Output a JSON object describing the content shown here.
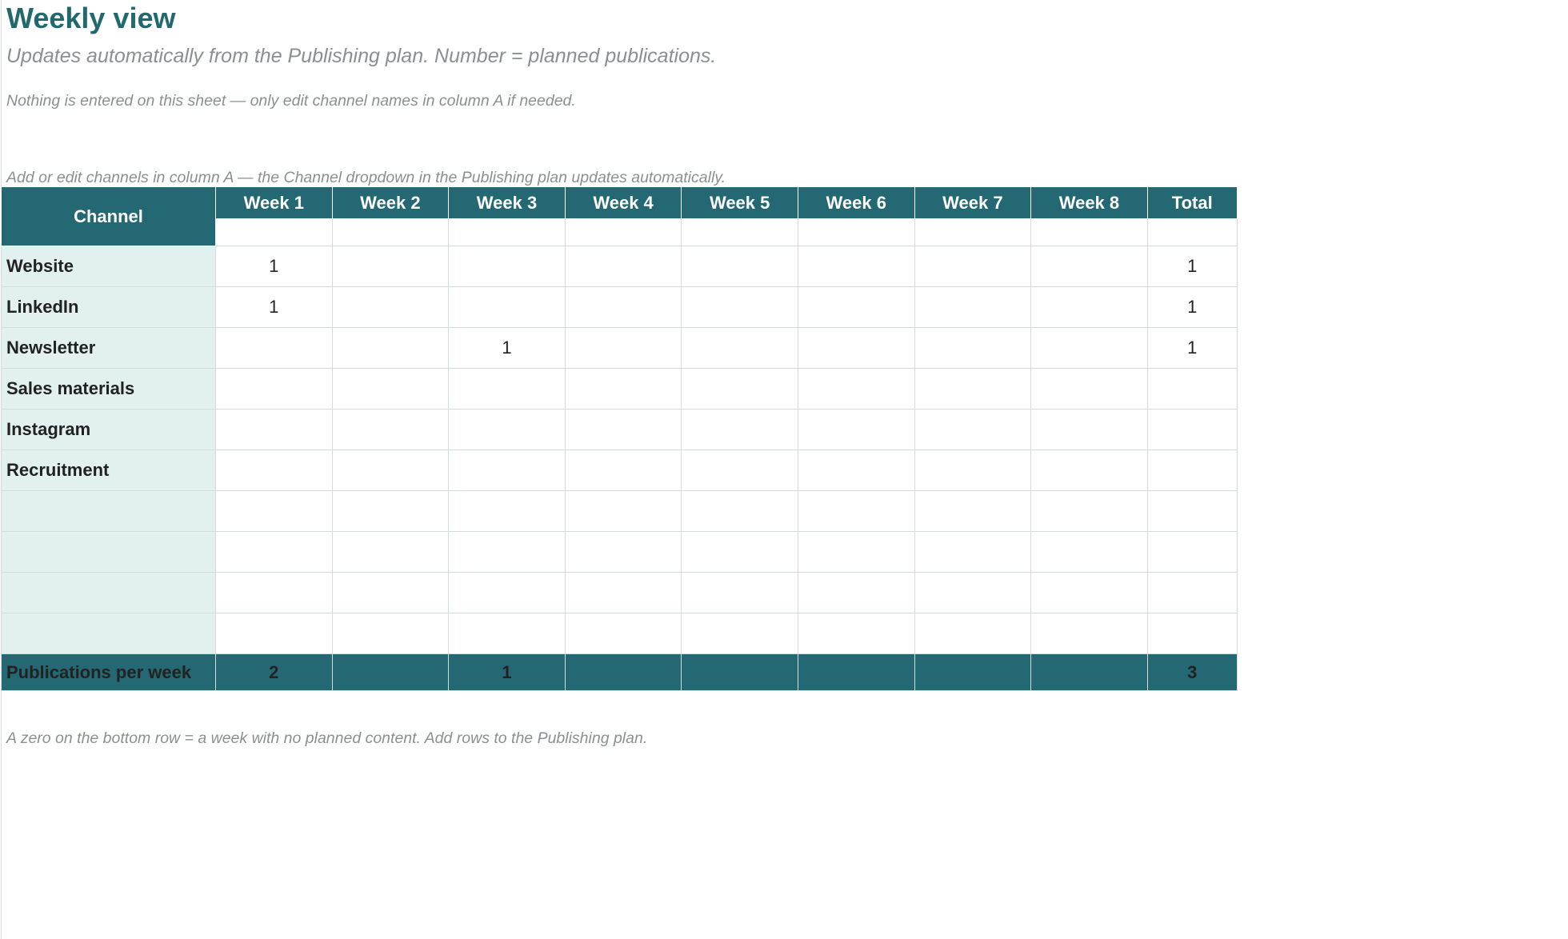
{
  "header": {
    "title": "Weekly view",
    "subtitle": "Updates automatically from the Publishing plan. Number = planned publications."
  },
  "notes": {
    "top": "Nothing is entered on this sheet — only edit channel names in column A if needed.",
    "above_table": "Add or edit channels in column A — the Channel dropdown in the Publishing plan updates automatically.",
    "bottom": "A zero on the bottom row = a week with no planned content. Add rows to the Publishing plan."
  },
  "table": {
    "channel_header": "Channel",
    "week_headers": [
      "Week 1",
      "Week 2",
      "Week 3",
      "Week 4",
      "Week 5",
      "Week 6",
      "Week 7",
      "Week 8"
    ],
    "total_header": "Total",
    "rows": [
      {
        "channel": "Website",
        "weeks": [
          "1",
          "",
          "",
          "",
          "",
          "",
          "",
          ""
        ],
        "total": "1"
      },
      {
        "channel": "LinkedIn",
        "weeks": [
          "1",
          "",
          "",
          "",
          "",
          "",
          "",
          ""
        ],
        "total": "1"
      },
      {
        "channel": "Newsletter",
        "weeks": [
          "",
          "",
          "1",
          "",
          "",
          "",
          "",
          ""
        ],
        "total": "1"
      },
      {
        "channel": "Sales materials",
        "weeks": [
          "",
          "",
          "",
          "",
          "",
          "",
          "",
          ""
        ],
        "total": ""
      },
      {
        "channel": "Instagram",
        "weeks": [
          "",
          "",
          "",
          "",
          "",
          "",
          "",
          ""
        ],
        "total": ""
      },
      {
        "channel": "Recruitment",
        "weeks": [
          "",
          "",
          "",
          "",
          "",
          "",
          "",
          ""
        ],
        "total": ""
      },
      {
        "channel": "",
        "weeks": [
          "",
          "",
          "",
          "",
          "",
          "",
          "",
          ""
        ],
        "total": ""
      },
      {
        "channel": "",
        "weeks": [
          "",
          "",
          "",
          "",
          "",
          "",
          "",
          ""
        ],
        "total": ""
      },
      {
        "channel": "",
        "weeks": [
          "",
          "",
          "",
          "",
          "",
          "",
          "",
          ""
        ],
        "total": ""
      },
      {
        "channel": "",
        "weeks": [
          "",
          "",
          "",
          "",
          "",
          "",
          "",
          ""
        ],
        "total": ""
      }
    ],
    "footer": {
      "label": "Publications per week",
      "weeks": [
        "2",
        "",
        "1",
        "",
        "",
        "",
        "",
        ""
      ],
      "total": "3"
    }
  },
  "colors": {
    "header_bg": "#236872",
    "title": "#22686f",
    "channel_bg": "#e3f0f0",
    "muted_text": "#8a8f92"
  }
}
